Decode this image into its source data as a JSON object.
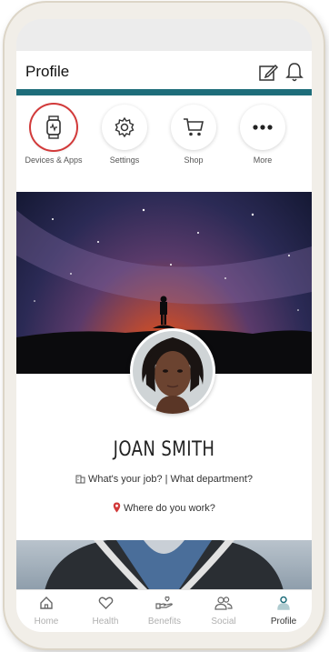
{
  "header": {
    "title": "Profile"
  },
  "quick_actions": [
    {
      "label": "Devices & Apps",
      "icon": "smartwatch-icon",
      "selected": true
    },
    {
      "label": "Settings",
      "icon": "gear-icon",
      "selected": false
    },
    {
      "label": "Shop",
      "icon": "cart-icon",
      "selected": false
    },
    {
      "label": "More",
      "icon": "more-dots-icon",
      "selected": false
    }
  ],
  "profile": {
    "name": "JOAN SMITH",
    "job_prompt": "What's your job? | What department?",
    "location_prompt": "Where do you work?"
  },
  "tabs": [
    {
      "label": "Home",
      "icon": "home-icon",
      "active": false
    },
    {
      "label": "Health",
      "icon": "heart-icon",
      "active": false
    },
    {
      "label": "Benefits",
      "icon": "benefits-hand-icon",
      "active": false
    },
    {
      "label": "Social",
      "icon": "people-icon",
      "active": false
    },
    {
      "label": "Profile",
      "icon": "person-icon",
      "active": true
    }
  ],
  "colors": {
    "accent": "#1e6d7a",
    "selection_ring": "#d23a3a",
    "location_pin": "#d23a3a"
  }
}
